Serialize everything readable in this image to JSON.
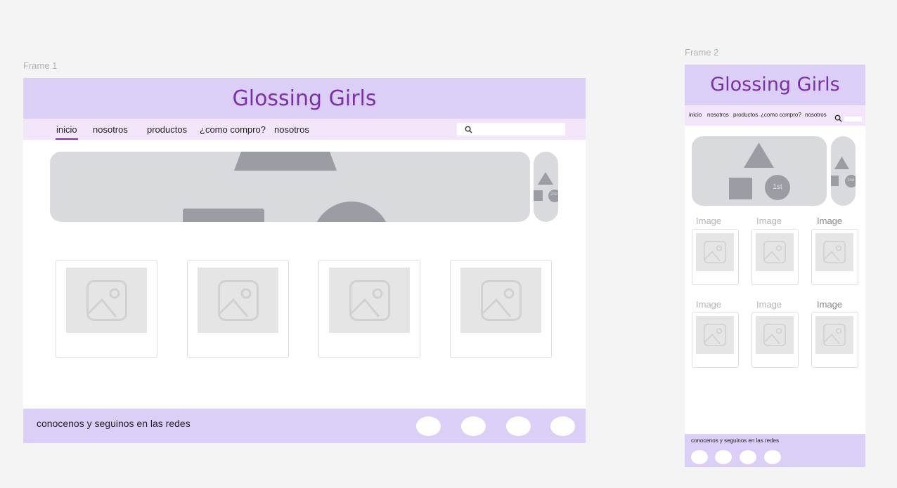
{
  "frames": {
    "frame1_label": "Frame 1",
    "frame2_label": "Frame 2"
  },
  "site": {
    "title": "Glossing Girls",
    "nav": [
      "inicio",
      "nosotros",
      "productos",
      "¿como compro?",
      "nosotros"
    ],
    "active_nav": "inicio",
    "search_placeholder": "",
    "footer_text": "conocenos y seguinos en las redes"
  },
  "carousel_mobile": {
    "slide1_badge": "1st",
    "slide2_badge": "2nd"
  },
  "mobile_grid": {
    "row1_labels": [
      "Image",
      "Image",
      "Image"
    ],
    "row2_labels": [
      "Image",
      "Image",
      "Image"
    ]
  },
  "colors": {
    "header_bg": "#dccff7",
    "nav_bg": "#f3e6fb",
    "title": "#7b2fa8",
    "placeholder": "#d9dadd",
    "shape": "#9a9da3"
  },
  "icons": {
    "search": "search-icon",
    "image": "image-placeholder-icon",
    "social": "social-icon"
  }
}
